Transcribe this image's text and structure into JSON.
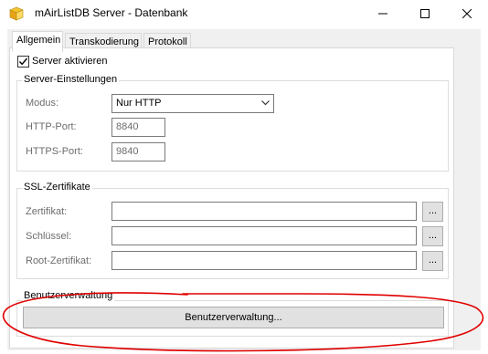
{
  "window": {
    "title": "mAirListDB Server - Datenbank",
    "icons": [
      "app-icon",
      "minimize-icon",
      "maximize-icon",
      "close-icon"
    ]
  },
  "tabs": [
    {
      "label": "Allgemein",
      "active": true
    },
    {
      "label": "Transkodierung",
      "active": false
    },
    {
      "label": "Protokoll",
      "active": false
    }
  ],
  "general": {
    "server_enable": {
      "label": "Server aktivieren",
      "checked": true
    }
  },
  "server_settings": {
    "title": "Server-Einstellungen",
    "mode_label": "Modus:",
    "mode_value": "Nur HTTP",
    "http_port_label": "HTTP-Port:",
    "http_port_value": "8840",
    "https_port_label": "HTTPS-Port:",
    "https_port_value": "9840"
  },
  "ssl": {
    "title": "SSL-Zertifikate",
    "certificate_label": "Zertifikat:",
    "key_label": "Schlüssel:",
    "root_certificate_label": "Root-Zertifikat:",
    "browse_label": "..."
  },
  "user_management": {
    "title": "Benutzerverwaltung",
    "button_label": "Benutzerverwaltung..."
  },
  "colors": {
    "annotation": "#e00000"
  }
}
